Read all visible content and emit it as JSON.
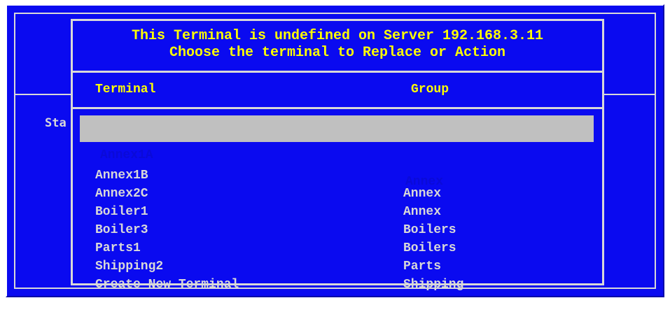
{
  "background": {
    "fragment_text": "Sta"
  },
  "dialog": {
    "title_line1": "This Terminal is undefined on Server 192.168.3.11",
    "title_line2": "Choose the terminal to Replace or Action",
    "columns": {
      "terminal": "Terminal",
      "group": "Group"
    },
    "rows": [
      {
        "terminal": "Annex1A",
        "group": "Annex",
        "selected": true
      },
      {
        "terminal": "Annex1B",
        "group": "Annex"
      },
      {
        "terminal": "Annex2C",
        "group": "Annex"
      },
      {
        "terminal": "Boiler1",
        "group": "Boilers"
      },
      {
        "terminal": "Boiler3",
        "group": "Boilers"
      },
      {
        "terminal": "Parts1",
        "group": "Parts"
      },
      {
        "terminal": "Shipping2",
        "group": "Shipping"
      },
      {
        "terminal": "Create New Terminal",
        "group": ""
      }
    ]
  },
  "colors": {
    "background_blue": "#0a0af0",
    "title_yellow": "#ffff00",
    "text_gray": "#d8d8d8",
    "selection_gray": "#c0c0c0"
  }
}
